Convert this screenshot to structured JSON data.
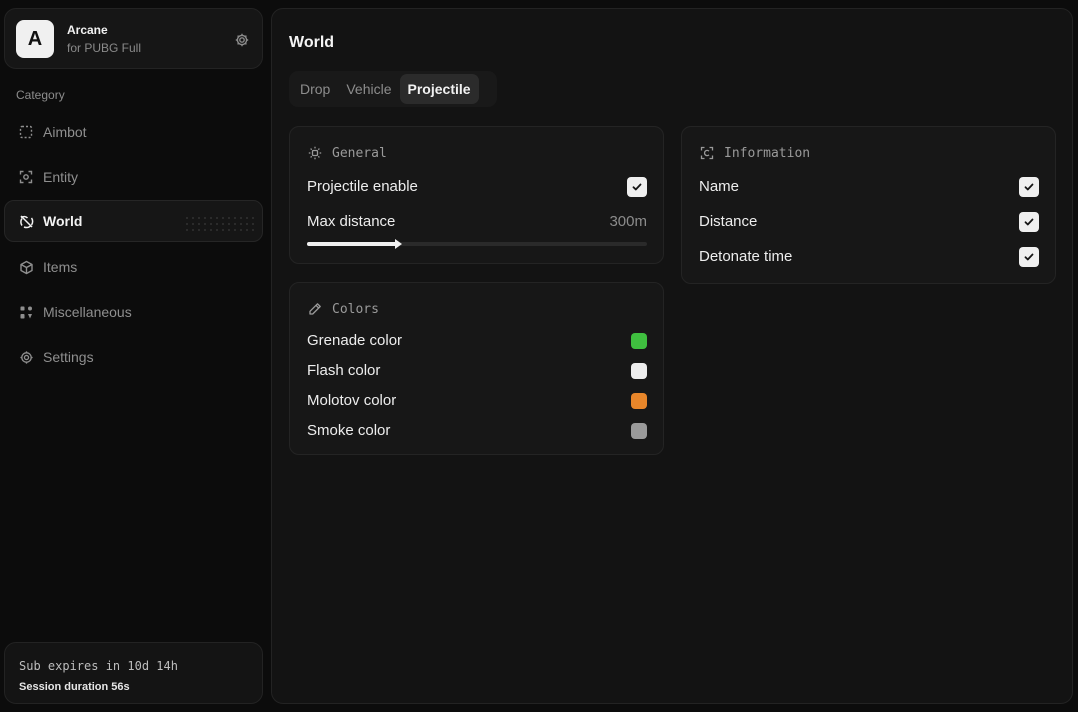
{
  "brand": {
    "logo_letter": "A",
    "name": "Arcane",
    "subtitle": "for PUBG Full"
  },
  "sidebar": {
    "category_label": "Category",
    "items": [
      {
        "label": "Aimbot",
        "icon": "crosshair-square-icon",
        "active": false
      },
      {
        "label": "Entity",
        "icon": "entity-target-icon",
        "active": false
      },
      {
        "label": "World",
        "icon": "globe-slash-icon",
        "active": true
      },
      {
        "label": "Items",
        "icon": "cube-icon",
        "active": false
      },
      {
        "label": "Miscellaneous",
        "icon": "misc-grid-icon",
        "active": false
      },
      {
        "label": "Settings",
        "icon": "gear-icon",
        "active": false
      }
    ]
  },
  "subscription": {
    "expires": "Sub expires in 10d 14h",
    "session": "Session duration 56s"
  },
  "main": {
    "title": "World",
    "tabs": [
      {
        "label": "Drop",
        "active": false
      },
      {
        "label": "Vehicle",
        "active": false
      },
      {
        "label": "Projectile",
        "active": true
      }
    ]
  },
  "general": {
    "title": "General",
    "projectile_enable_label": "Projectile enable",
    "projectile_enable_checked": true,
    "max_distance_label": "Max distance",
    "max_distance_value": "300m",
    "max_distance_fraction": 0.27
  },
  "colors": {
    "title": "Colors",
    "items": [
      {
        "label": "Grenade color",
        "color": "#3fbf3f"
      },
      {
        "label": "Flash color",
        "color": "#ededed"
      },
      {
        "label": "Molotov color",
        "color": "#e8862a"
      },
      {
        "label": "Smoke color",
        "color": "#9a9a9a"
      }
    ]
  },
  "information": {
    "title": "Information",
    "items": [
      {
        "label": "Name",
        "checked": true
      },
      {
        "label": "Distance",
        "checked": true
      },
      {
        "label": "Detonate time",
        "checked": true
      }
    ]
  }
}
